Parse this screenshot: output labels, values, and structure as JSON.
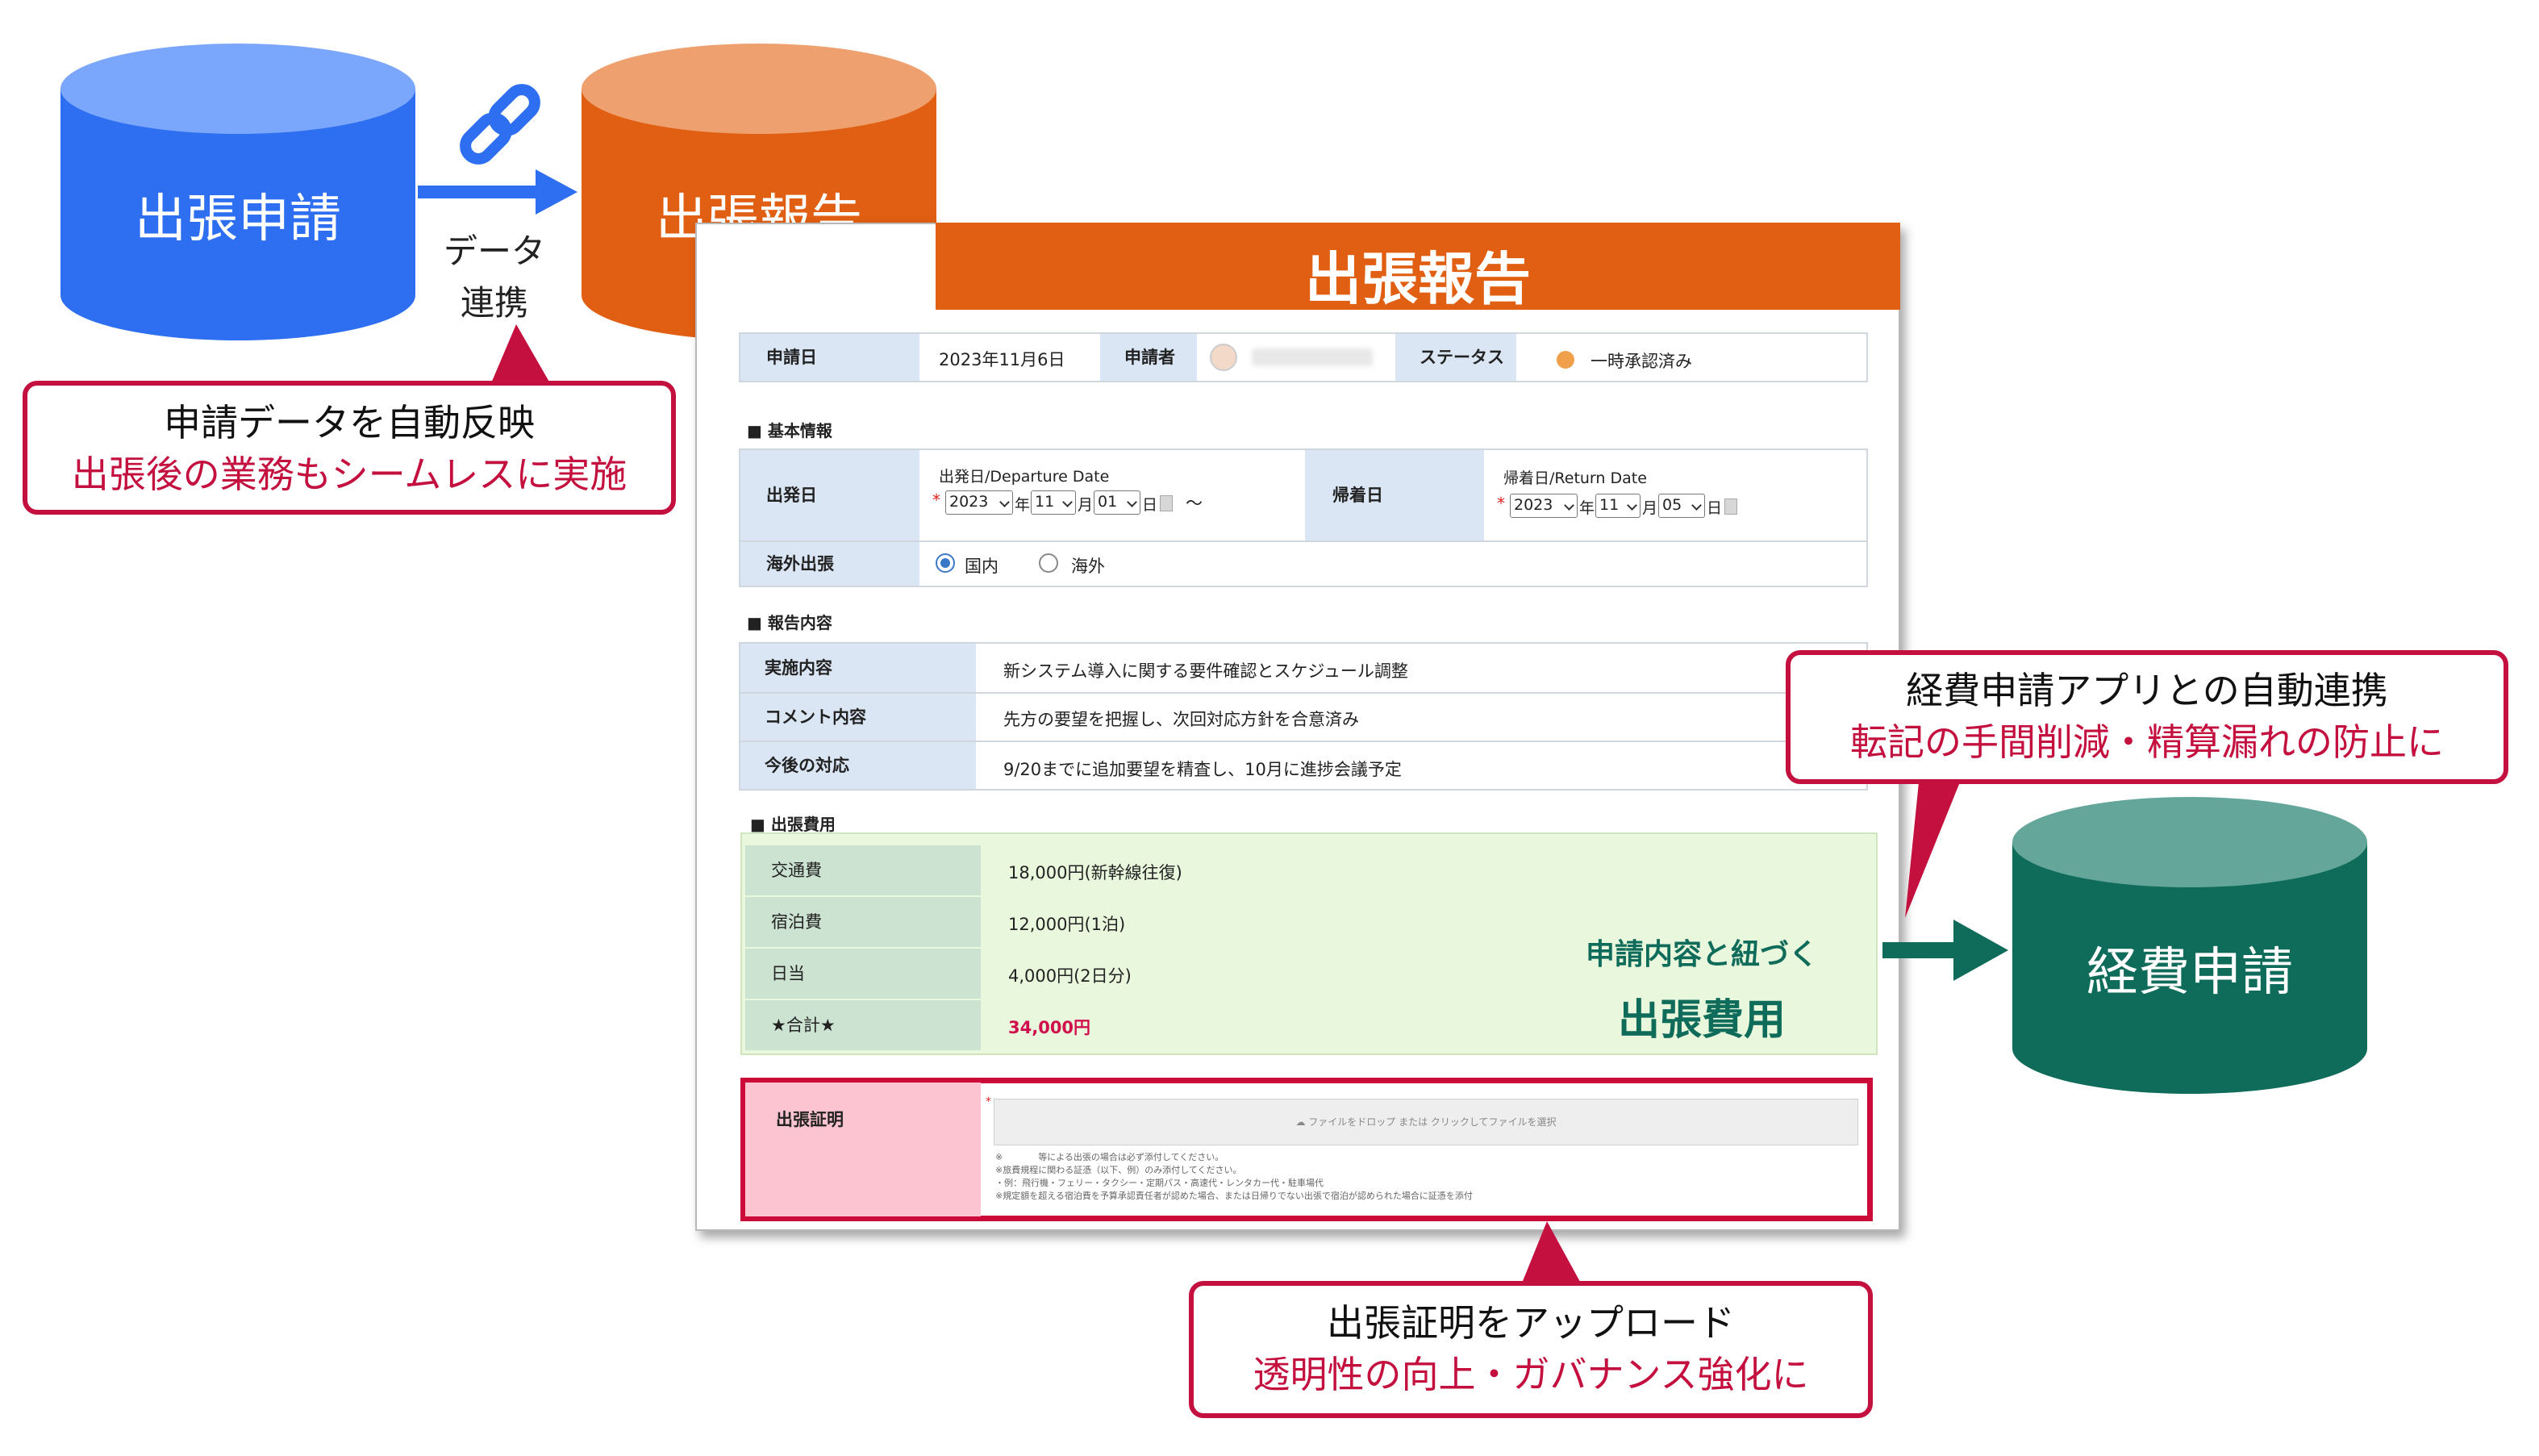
{
  "diagram": {
    "db_application": "出張申請",
    "db_report": "出張報告",
    "db_expense": "経費申請",
    "link_label_line1": "データ",
    "link_label_line2": "連携",
    "callout_top": {
      "line1": "申請データを自動反映",
      "line2": "出張後の業務もシームレスに実施"
    },
    "callout_right": {
      "line1": "経費申請アプリとの自動連携",
      "line2": "転記の手間削減・精算漏れの防止に"
    },
    "callout_bottom": {
      "line1": "出張証明をアップロード",
      "line2": "透明性の向上・ガバナンス強化に"
    },
    "green_note_line1": "申請内容と紐づく",
    "green_note_line2": "出張費用",
    "colors": {
      "blue": "#2d6ff0",
      "orange": "#e05f12",
      "green": "#0f6b5a",
      "red": "#c4103f"
    }
  },
  "form": {
    "title": "出張報告",
    "header_row": {
      "date_label": "申請日",
      "date_value": "2023年11月6日",
      "applicant_label": "申請者",
      "status_label": "ステータス",
      "status_value": "一時承認済み"
    },
    "basic_section": "■ 基本情報",
    "departure": {
      "label": "出発日",
      "sublabel": "出発日/Departure Date",
      "year": "2023",
      "year_unit": "年",
      "month": "11",
      "month_unit": "月",
      "day": "01",
      "day_unit": "日",
      "tilde": "〜"
    },
    "return": {
      "label": "帰着日",
      "sublabel": "帰着日/Return Date",
      "year": "2023",
      "year_unit": "年",
      "month": "11",
      "month_unit": "月",
      "day": "05",
      "day_unit": "日"
    },
    "overseas": {
      "label": "海外出張",
      "option_domestic": "国内",
      "option_overseas": "海外"
    },
    "report_section": "■ 報告内容",
    "report_rows": [
      {
        "label": "実施内容",
        "value": "新システム導入に関する要件確認とスケジュール調整"
      },
      {
        "label": "コメント内容",
        "value": "先方の要望を把握し、次回対応方針を合意済み"
      },
      {
        "label": "今後の対応",
        "value": "9/20までに追加要望を精査し、10月に進捗会議予定"
      }
    ],
    "cost_section": "■ 出張費用",
    "cost_rows": [
      {
        "label": "交通費",
        "value": "18,000円(新幹線往復)"
      },
      {
        "label": "宿泊費",
        "value": "12,000円(1泊)"
      },
      {
        "label": "日当",
        "value": "4,000円(2日分)"
      },
      {
        "label": "★合計★",
        "value": "34,000円"
      }
    ],
    "proof": {
      "label": "出張証明",
      "drop_text": "ファイルをドロップ または クリックしてファイルを選択",
      "notes": [
        "※　　　　等による出張の場合は必ず添付してください。",
        "※旅費規程に関わる証憑（以下、例）のみ添付してください。",
        "・例：飛行機・フェリー・タクシー・定期パス・高速代・レンタカー代・駐車場代",
        "※規定額を超える宿泊費を予算承認責任者が認めた場合、または日帰りでない出張で宿泊が認められた場合に証憑を添付"
      ]
    }
  }
}
